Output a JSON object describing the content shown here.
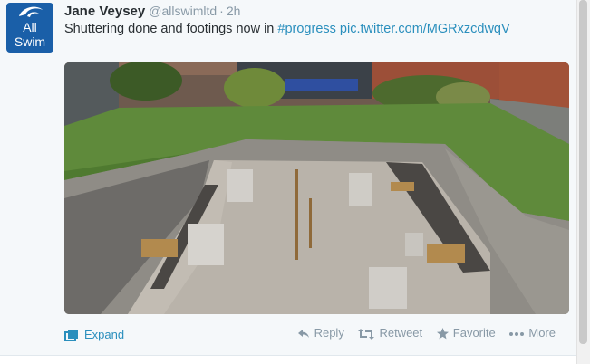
{
  "tweet": {
    "avatar": {
      "icon": "allswim-logo",
      "line1": "All",
      "line2": "Swim"
    },
    "fullname": "Jane Veysey",
    "username": "@allswimltd",
    "separator": "·",
    "time": "2h",
    "text_plain": "Shuttering done and footings now in ",
    "hashtag": "#progress",
    "link": "pic.twitter.com/MGRxzcdwqV",
    "media": {
      "description_icon": "photo-construction-pool-excavation"
    }
  },
  "footer": {
    "expand": {
      "label": "Expand",
      "icon": "expand-icon"
    },
    "actions": [
      {
        "label": "Reply",
        "icon": "reply-icon"
      },
      {
        "label": "Retweet",
        "icon": "retweet-icon"
      },
      {
        "label": "Favorite",
        "icon": "star-icon"
      },
      {
        "label": "More",
        "icon": "more-dots-icon"
      }
    ]
  },
  "colors": {
    "link": "#2a8fbd",
    "muted": "#8899a6",
    "background": "#f5f8fa",
    "avatar_bg": "#1a5fa8"
  }
}
